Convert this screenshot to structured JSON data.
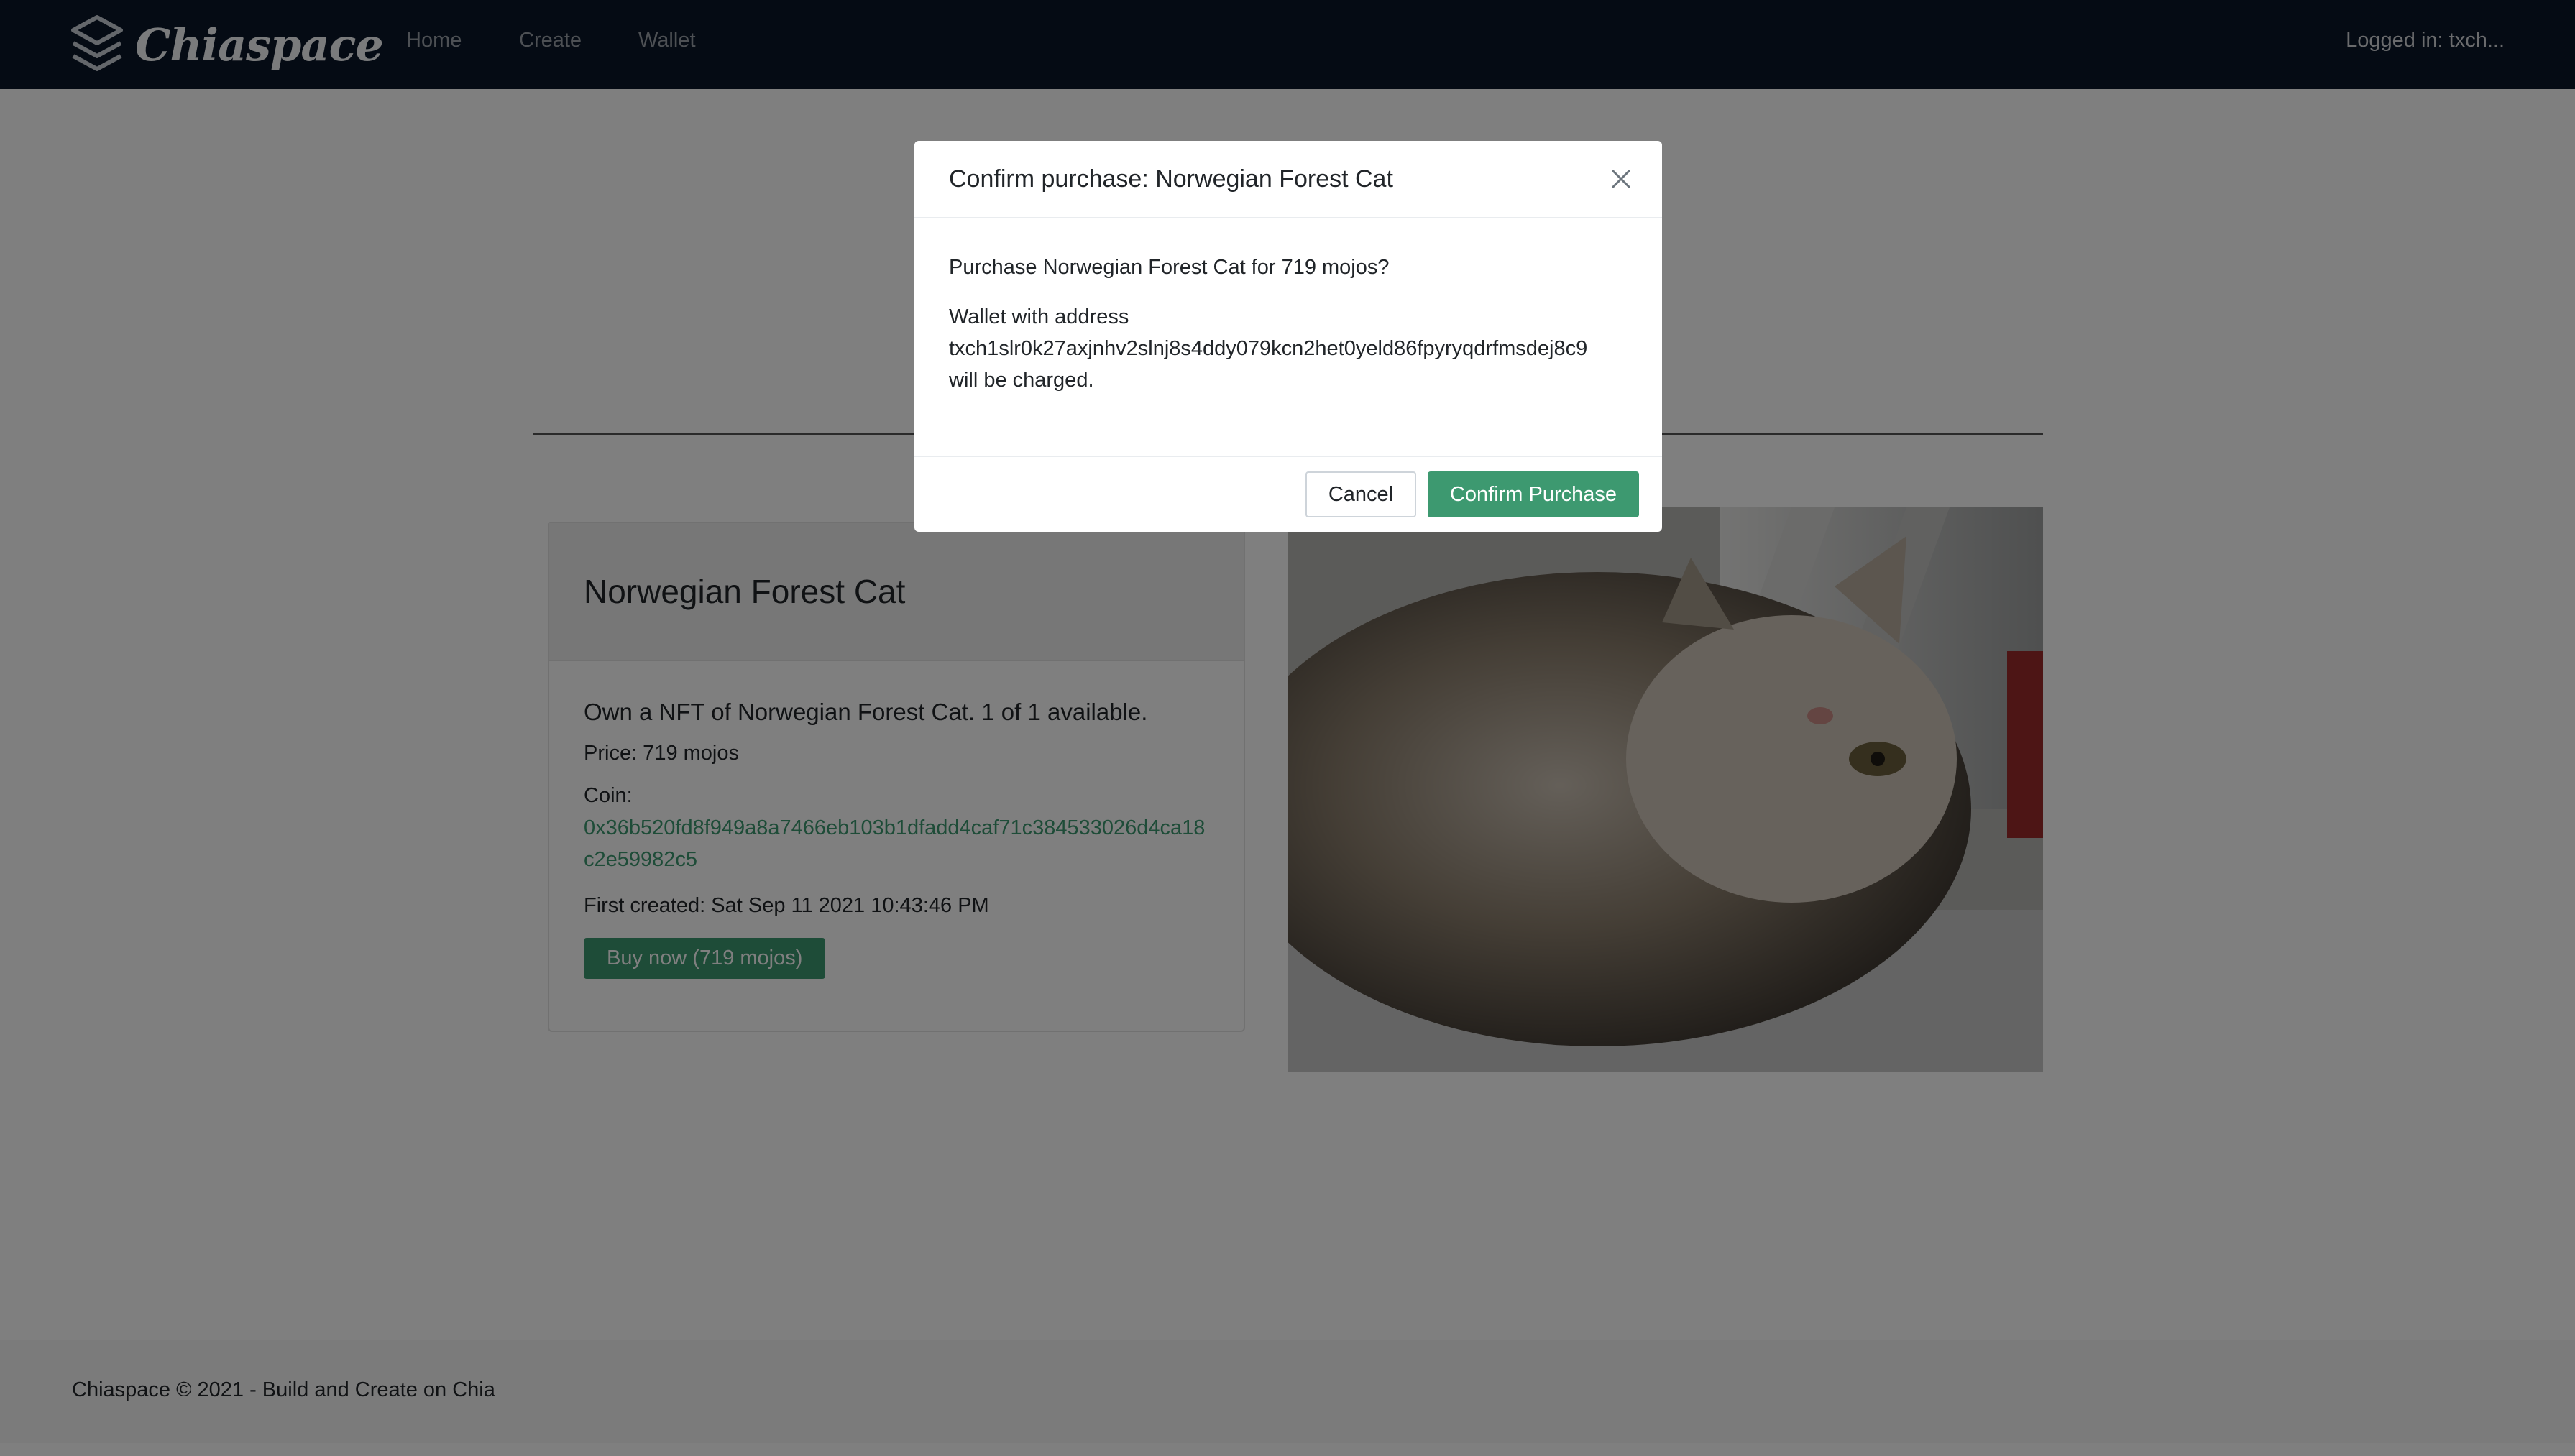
{
  "navbar": {
    "brand": "Chiaspace",
    "links": [
      "Home",
      "Create",
      "Wallet"
    ],
    "user": "Logged in: txch..."
  },
  "page": {
    "coin_heading": "0x36b520fd8f949a8a7466eb103b1dfadd4caf71c384533026d4ca18c2e59982c5",
    "card": {
      "title": "Norwegian Forest Cat",
      "lead": "Own a NFT of Norwegian Forest Cat. 1 of 1 available.",
      "price": "Price: 719 mojos",
      "coin_label": "Coin:",
      "coin_value": "0x36b520fd8f949a8a7466eb103b1dfadd4caf71c384533026d4ca18c2e59982c5",
      "created": "First created: Sat Sep 11 2021 10:43:46 PM",
      "buy_label": "Buy now (719 mojos)"
    }
  },
  "footer": {
    "text": "Chiaspace © 2021 - Build and Create on Chia"
  },
  "modal": {
    "title": "Confirm purchase: Norwegian Forest Cat",
    "question": "Purchase Norwegian Forest Cat for 719 mojos?",
    "wallet_line1": "Wallet with address",
    "wallet_address": "txch1slr0k27axjnhv2slnj8s4ddy079kcn2het0yeld86fpyryqdrfmsdej8c9",
    "wallet_line3": "will be charged.",
    "cancel_label": "Cancel",
    "confirm_label": "Confirm Purchase"
  },
  "colors": {
    "navbar_bg": "#0a1628",
    "accent": "#3d9970",
    "backdrop": "rgba(0,0,0,0.5)"
  }
}
